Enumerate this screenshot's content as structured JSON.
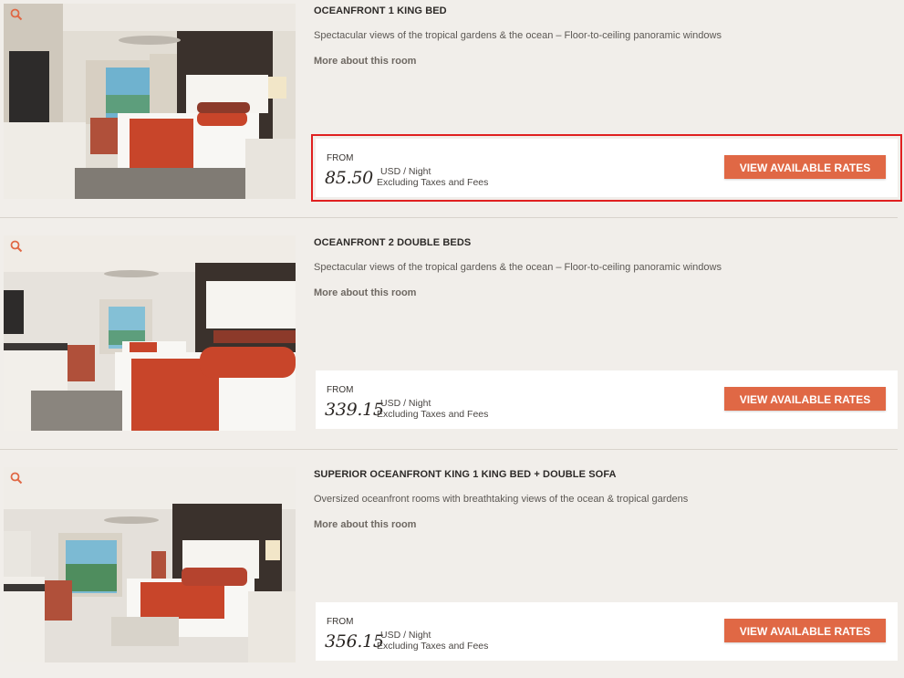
{
  "rooms": [
    {
      "title": "OCEANFRONT 1 KING BED",
      "description": "Spectacular views of the tropical gardens & the ocean – Floor-to-ceiling panoramic windows",
      "more_link": "More about this room",
      "from_label": "FROM",
      "price": "85.50",
      "unit": "USD / Night",
      "fees_note": "Excluding Taxes and Fees",
      "button_label": "VIEW AVAILABLE RATES",
      "highlighted": true
    },
    {
      "title": "OCEANFRONT 2 DOUBLE BEDS",
      "description": "Spectacular views of the tropical gardens & the ocean – Floor-to-ceiling panoramic windows",
      "more_link": "More about this room",
      "from_label": "FROM",
      "price": "339.15",
      "unit": "USD / Night",
      "fees_note": "Excluding Taxes and Fees",
      "button_label": "VIEW AVAILABLE RATES",
      "highlighted": false
    },
    {
      "title": "SUPERIOR OCEANFRONT KING 1 KING BED + DOUBLE SOFA",
      "description": "Oversized oceanfront rooms with breathtaking views of the ocean & tropical gardens",
      "more_link": "More about this room",
      "from_label": "FROM",
      "price": "356.15",
      "unit": "USD / Night",
      "fees_note": "Excluding Taxes and Fees",
      "button_label": "VIEW AVAILABLE RATES",
      "highlighted": false
    }
  ],
  "colors": {
    "background": "#f1eeea",
    "button": "#e06845",
    "highlight_outline": "#e02020",
    "bedspread_accent": "#c8452a"
  },
  "icons": {
    "photo_zoom": "zoom-icon"
  }
}
